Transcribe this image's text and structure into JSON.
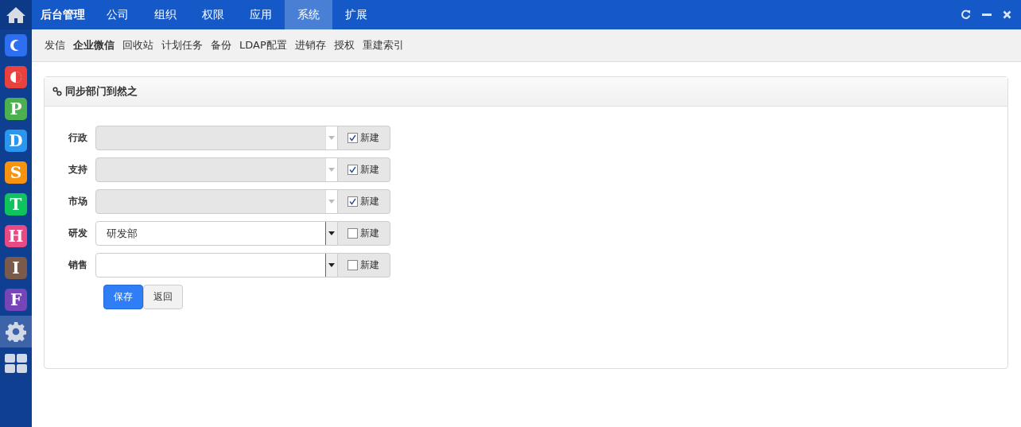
{
  "top_nav": {
    "brand": "后台管理",
    "items": [
      {
        "label": "公司",
        "selected": false
      },
      {
        "label": "组织",
        "selected": false
      },
      {
        "label": "权限",
        "selected": false
      },
      {
        "label": "应用",
        "selected": false
      },
      {
        "label": "系统",
        "selected": true
      },
      {
        "label": "扩展",
        "selected": false
      }
    ]
  },
  "sidebar": {
    "apps": [
      {
        "kind": "moon",
        "color": "#2d6ff0",
        "selected": false
      },
      {
        "kind": "half",
        "color": "#e8413e",
        "selected": false
      },
      {
        "kind": "letter",
        "label": "P",
        "color": "#4caf50",
        "selected": false
      },
      {
        "kind": "letter",
        "label": "D",
        "color": "#2a96ef",
        "selected": false
      },
      {
        "kind": "letter",
        "label": "S",
        "color": "#f7930f",
        "selected": false
      },
      {
        "kind": "letter",
        "label": "T",
        "color": "#0fc45c",
        "selected": false
      },
      {
        "kind": "letter",
        "label": "H",
        "color": "#ea4a83",
        "selected": false
      },
      {
        "kind": "letter",
        "label": "I",
        "color": "#7a5a4a",
        "selected": false
      },
      {
        "kind": "letter",
        "label": "F",
        "color": "#7645b8",
        "selected": false
      },
      {
        "kind": "gear",
        "selected": true
      },
      {
        "kind": "grid",
        "selected": false
      }
    ]
  },
  "sub_nav": [
    {
      "label": "发信",
      "selected": false
    },
    {
      "label": "企业微信",
      "selected": true
    },
    {
      "label": "回收站",
      "selected": false
    },
    {
      "label": "计划任务",
      "selected": false
    },
    {
      "label": "备份",
      "selected": false
    },
    {
      "label": "LDAP配置",
      "selected": false
    },
    {
      "label": "进销存",
      "selected": false
    },
    {
      "label": "授权",
      "selected": false
    },
    {
      "label": "重建索引",
      "selected": false
    }
  ],
  "panel": {
    "title": "同步部门到然之",
    "rows": [
      {
        "label": "行政",
        "disabled": true,
        "checked": true,
        "checkbox_label": "新建"
      },
      {
        "label": "支持",
        "disabled": true,
        "checked": true,
        "checkbox_label": "新建"
      },
      {
        "label": "市场",
        "disabled": true,
        "checked": true,
        "checkbox_label": "新建"
      },
      {
        "label": "研发",
        "value": "研发部",
        "disabled": false,
        "checked": false,
        "checkbox_label": "新建"
      },
      {
        "label": "销售",
        "disabled": false,
        "checked": false,
        "checkbox_label": "新建"
      }
    ],
    "buttons": [
      {
        "label": "保存",
        "kind": "primary"
      },
      {
        "label": "返回",
        "kind": "default"
      }
    ]
  }
}
